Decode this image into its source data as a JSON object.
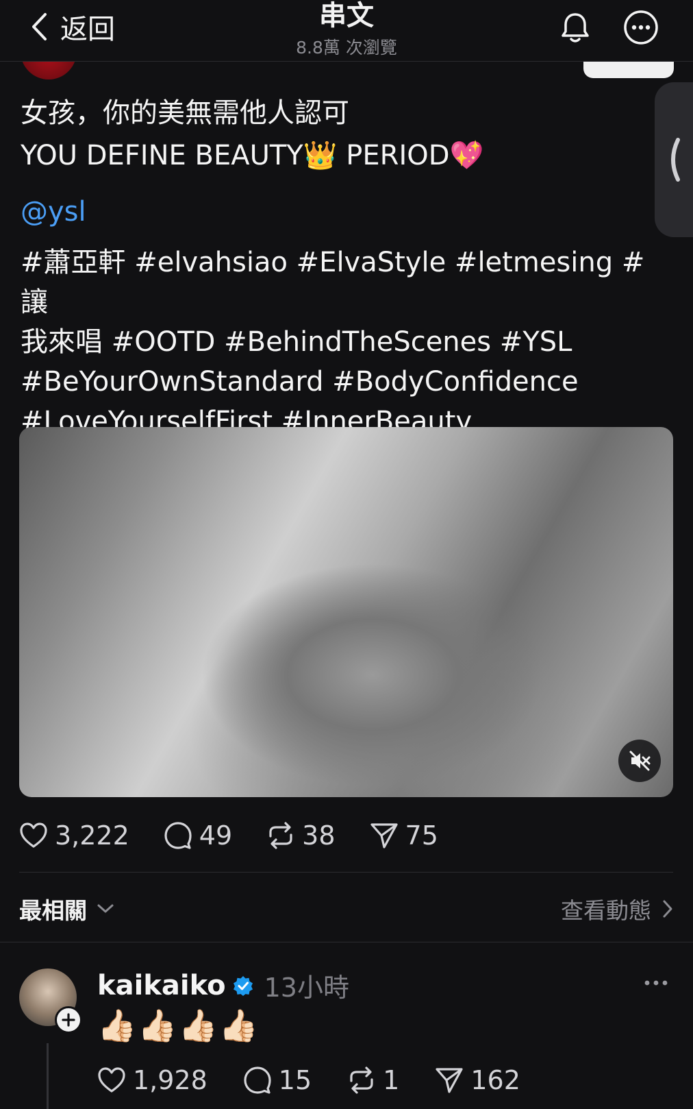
{
  "header": {
    "back_label": "返回",
    "title": "串文",
    "views": "8.8萬 次瀏覽"
  },
  "post": {
    "text_line1": "女孩，你的美無需他人認可",
    "text_line2": "YOU DEFINE BEAUTY👑 PERIOD💖",
    "mention": "@ysl",
    "tags_line1": "#蕭亞軒 #elvahsiao #ElvaStyle #letmesing #讓",
    "tags_line2": "我來唱 #OOTD #BehindTheScenes #YSL",
    "tags_line3": "#BeYourOwnStandard #BodyConfidence",
    "tags_line4": "#LoveYourselfFirst #InnerBeauty"
  },
  "stats": {
    "likes": "3,222",
    "comments": "49",
    "reposts": "38",
    "shares": "75"
  },
  "sort": {
    "label": "最相關",
    "activity_link": "查看動態"
  },
  "reply": {
    "username": "kaikaiko",
    "time": "13小時",
    "text": "👍🏻👍🏻👍🏻👍🏻",
    "likes": "1,928",
    "comments": "15",
    "reposts": "1",
    "shares": "162"
  },
  "colors": {
    "background": "#111113",
    "text": "#f3f3f3",
    "muted": "#8c8c92",
    "link": "#4b9ef5",
    "verified": "#1d9bf0"
  }
}
